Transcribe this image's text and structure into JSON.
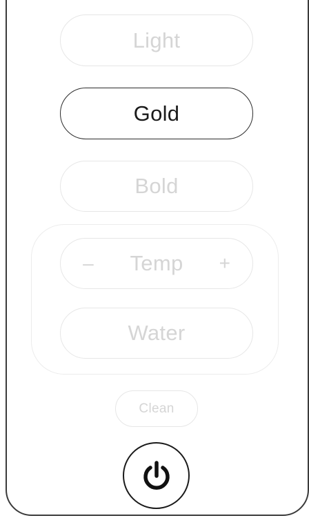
{
  "modes": {
    "light": "Light",
    "gold": "Gold",
    "bold": "Bold"
  },
  "settings": {
    "temp_label": "Temp",
    "temp_minus": "–",
    "temp_plus": "+",
    "water_label": "Water"
  },
  "clean_label": "Clean",
  "power_icon": "power-icon",
  "selected_mode": "Gold",
  "colors": {
    "active": "#1a1a1a",
    "inactive": "#d5d5d5",
    "outline": "#3a3a3a"
  }
}
